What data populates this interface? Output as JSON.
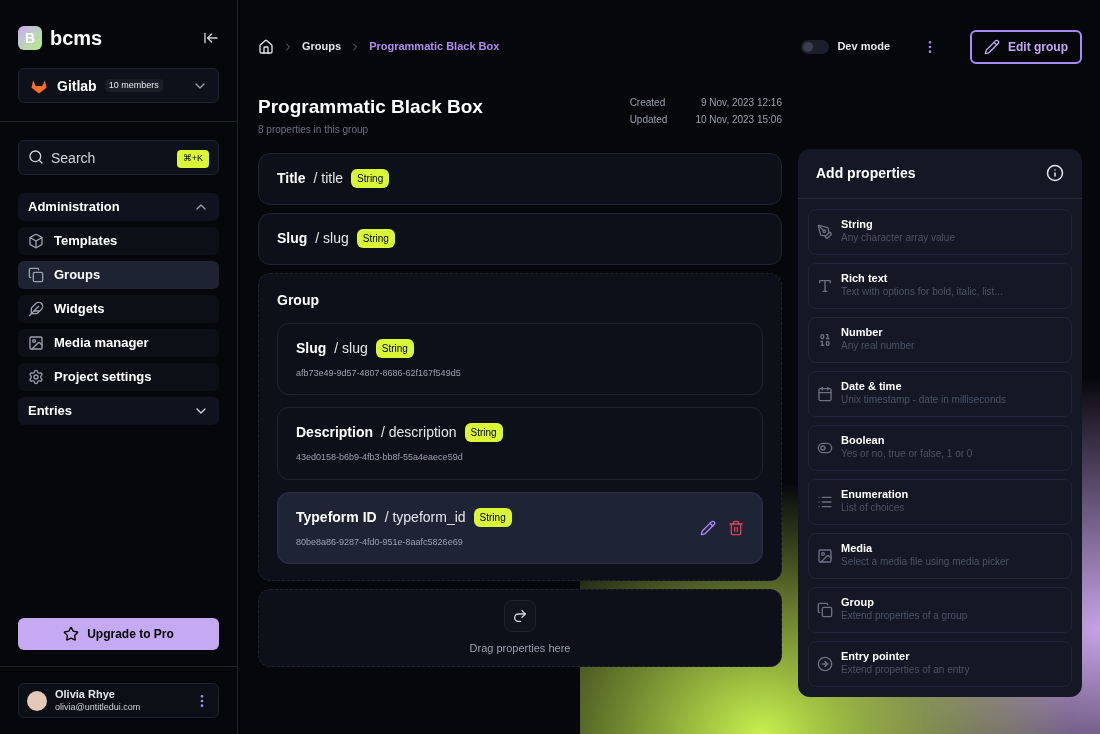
{
  "brand": {
    "name": "bcms",
    "logo_letter": "B"
  },
  "workspace": {
    "name": "Gitlab",
    "members": "10 members"
  },
  "search": {
    "placeholder": "Search",
    "shortcut": "⌘+K"
  },
  "nav_sections": [
    {
      "label": "Administration",
      "expanded": true,
      "items": [
        {
          "label": "Templates",
          "kind": "templates",
          "selected": false
        },
        {
          "label": "Groups",
          "kind": "groups",
          "selected": true
        },
        {
          "label": "Widgets",
          "kind": "widgets",
          "selected": false
        },
        {
          "label": "Media manager",
          "kind": "media",
          "selected": false
        },
        {
          "label": "Project settings",
          "kind": "settings",
          "selected": false
        }
      ]
    },
    {
      "label": "Entries",
      "expanded": false
    }
  ],
  "upgrade_button": "Upgrade to Pro",
  "user": {
    "name": "Olivia Rhye",
    "email": "olivia@untitledui.com"
  },
  "breadcrumb": [
    {
      "label": "Groups",
      "selected": false
    },
    {
      "label": "Programmatic Black Box",
      "selected": true
    }
  ],
  "dev_mode": {
    "label": "Dev mode",
    "on": false
  },
  "edit_button": "Edit group",
  "page": {
    "title": "Programmatic Black Box",
    "subtitle": "8 properties in this group",
    "meta": [
      {
        "label": "Created",
        "value": "9 Nov, 2023 12:16"
      },
      {
        "label": "Updated",
        "value": "10 Nov, 2023 15:06"
      }
    ]
  },
  "fields": [
    {
      "kind": "field",
      "name": "Title",
      "key": "/ title",
      "type": "String"
    },
    {
      "kind": "field",
      "name": "Slug",
      "key": "/ slug",
      "type": "String"
    },
    {
      "kind": "group",
      "name": "Group",
      "children": [
        {
          "name": "Slug",
          "key": "/ slug",
          "type": "String",
          "id": "afb73e49-9d57-4807-8686-62f167f549d5",
          "highlighted": false
        },
        {
          "name": "Description",
          "key": "/ description",
          "type": "String",
          "id": "43ed0158-b6b9-4fb3-bb8f-55a4eaece59d",
          "highlighted": false
        },
        {
          "name": "Typeform ID",
          "key": "/ typeform_id",
          "type": "String",
          "id": "80be8a86-9287-4fd0-951e-8aafc5826e69",
          "highlighted": true
        }
      ]
    }
  ],
  "drop_zone": "Drag properties here",
  "add_properties": {
    "title": "Add properties",
    "items": [
      {
        "kind": "string",
        "label": "String",
        "description": "Any character array value"
      },
      {
        "kind": "richtext",
        "label": "Rich text",
        "description": "Text with options for bold, italic, list..."
      },
      {
        "kind": "number",
        "label": "Number",
        "description": "Any real number"
      },
      {
        "kind": "date",
        "label": "Date & time",
        "description": "Unix timestamp - date in milliseconds"
      },
      {
        "kind": "boolean",
        "label": "Boolean",
        "description": "Yes or no, true or false, 1 or 0"
      },
      {
        "kind": "enumeration",
        "label": "Enumeration",
        "description": "List of choices"
      },
      {
        "kind": "media",
        "label": "Media",
        "description": "Select a media file using media picker"
      },
      {
        "kind": "group",
        "label": "Group",
        "description": "Extend properties of a group"
      },
      {
        "kind": "pointer",
        "label": "Entry pointer",
        "description": "Extend properties of an entry"
      }
    ]
  }
}
